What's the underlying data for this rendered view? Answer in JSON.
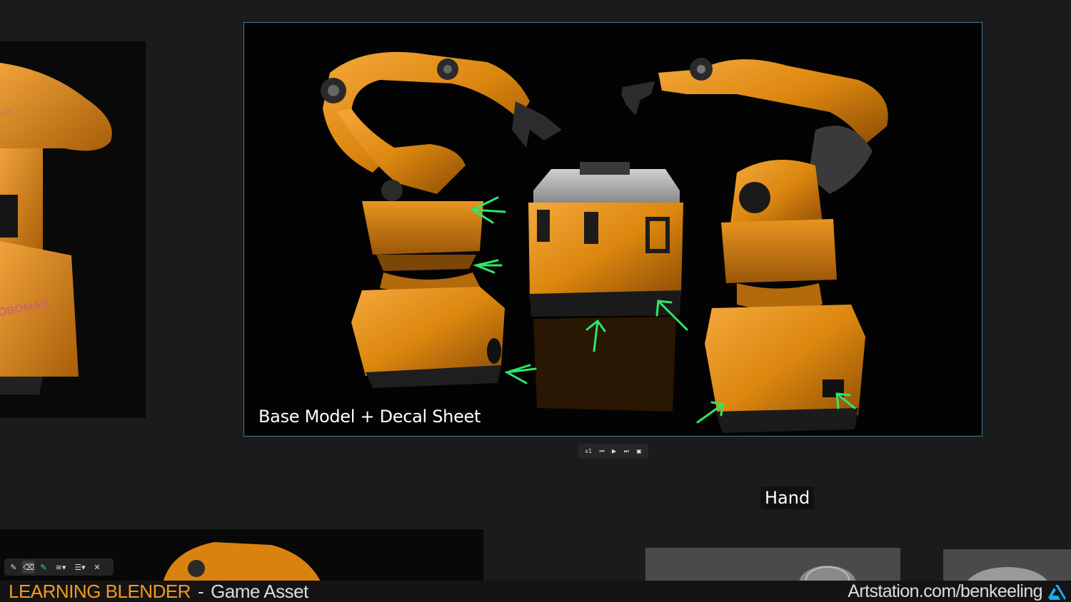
{
  "slide": {
    "caption": "Base Model + Decal Sheet",
    "image_description": "two orange industrial robot arms and an orange case on black background"
  },
  "controls": {
    "speed": "x1",
    "prev_icon": "skip-back-icon",
    "play_icon": "play-icon",
    "next_icon": "skip-forward-icon",
    "fullscreen_icon": "fullscreen-icon"
  },
  "tooltip": {
    "text": "Hand"
  },
  "left_thumb": {
    "text": "OBOMAN",
    "small_text": "MAN"
  },
  "annotation_toolbar": {
    "tools": [
      "pen-icon",
      "eraser-icon",
      "highlighter-icon",
      "line-weight-icon",
      "layout-icon",
      "close-icon"
    ]
  },
  "footer": {
    "brand_primary": "LEARNING BLENDER",
    "separator": "-",
    "brand_secondary": "Game Asset",
    "site": "Artstation.com/benkeeling"
  },
  "colors": {
    "accent_orange": "#f39a1e",
    "annotation_green": "#2de86a",
    "slide_border": "#3e7d96",
    "robot_orange": "#d9820f"
  }
}
